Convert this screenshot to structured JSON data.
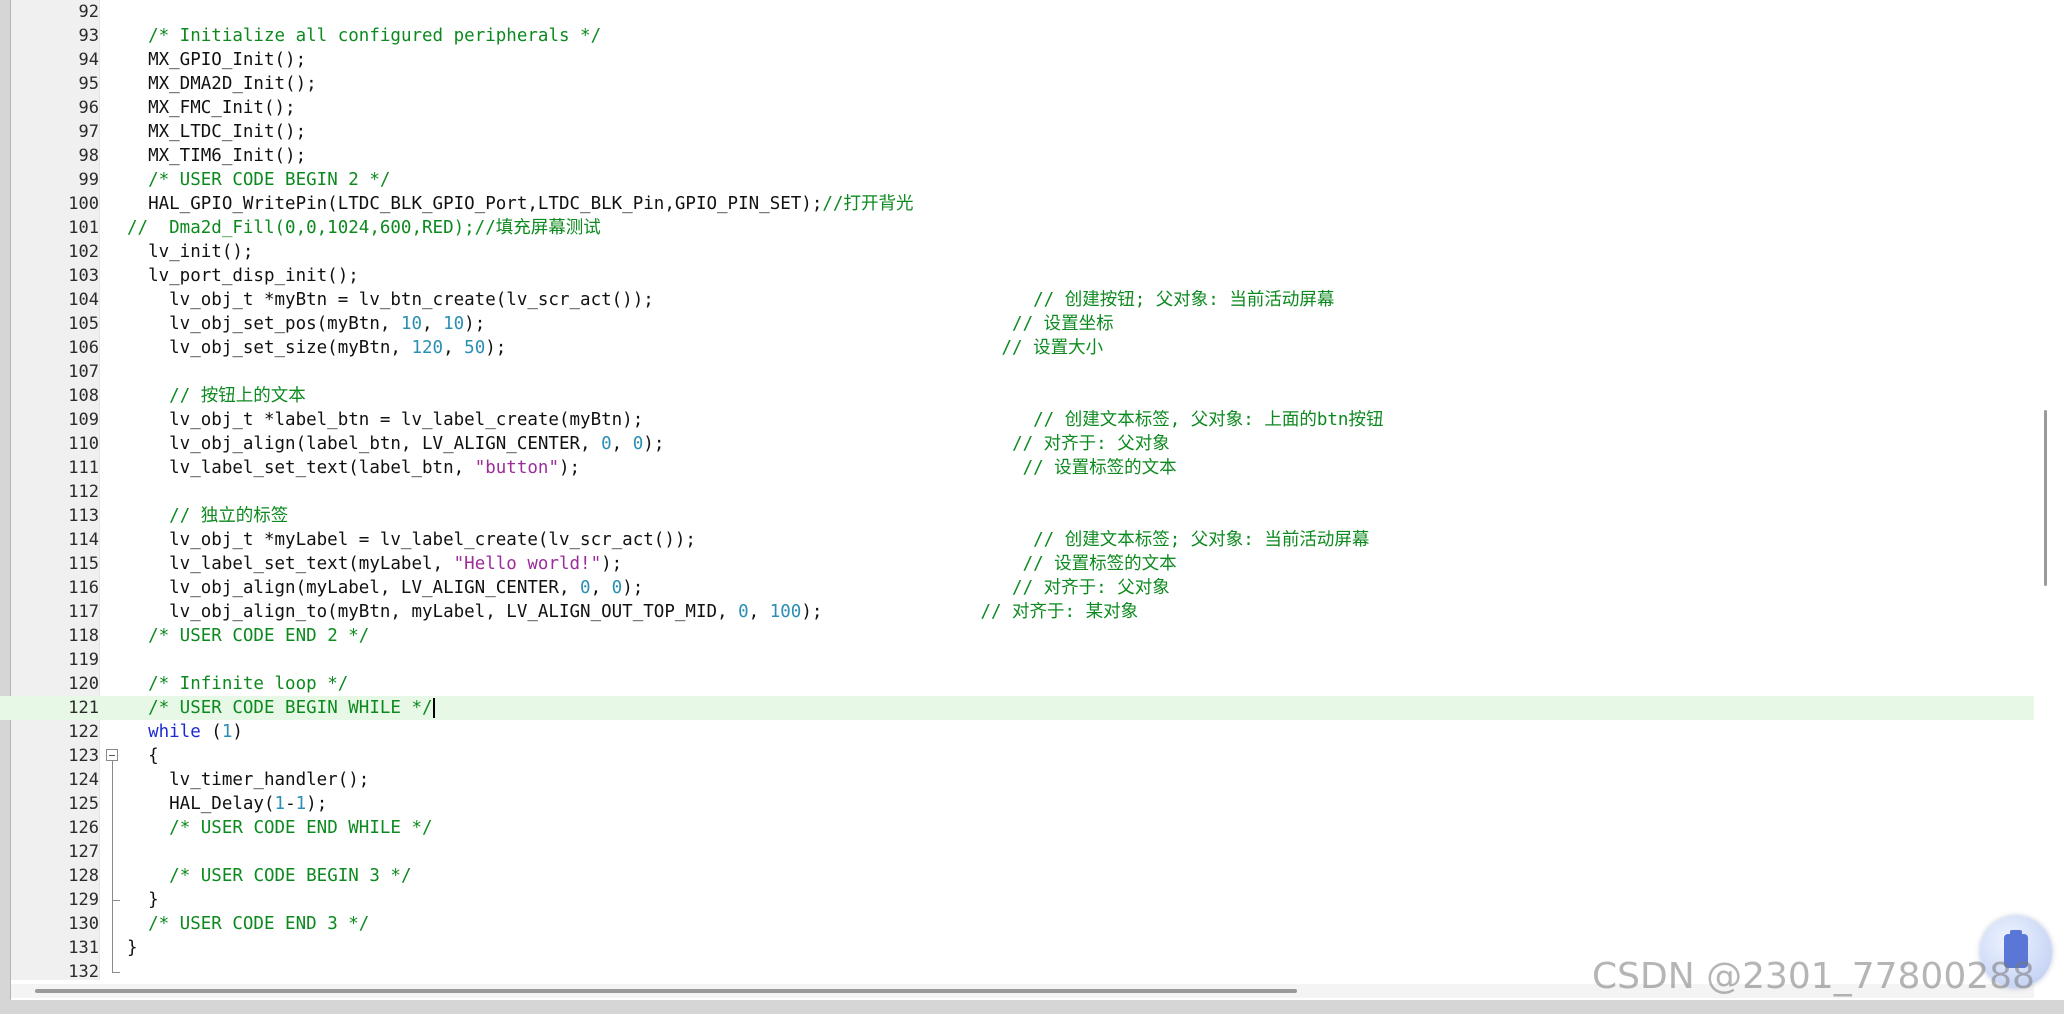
{
  "editor": {
    "lines": [
      {
        "n": "92",
        "parts": []
      },
      {
        "n": "93",
        "parts": [
          {
            "t": "  "
          },
          {
            "t": "/* Initialize all configured peripherals */",
            "c": "cm"
          }
        ]
      },
      {
        "n": "94",
        "parts": [
          {
            "t": "  MX_GPIO_Init();"
          }
        ]
      },
      {
        "n": "95",
        "parts": [
          {
            "t": "  MX_DMA2D_Init();"
          }
        ]
      },
      {
        "n": "96",
        "parts": [
          {
            "t": "  MX_FMC_Init();"
          }
        ]
      },
      {
        "n": "97",
        "parts": [
          {
            "t": "  MX_LTDC_Init();"
          }
        ]
      },
      {
        "n": "98",
        "parts": [
          {
            "t": "  MX_TIM6_Init();"
          }
        ]
      },
      {
        "n": "99",
        "parts": [
          {
            "t": "  "
          },
          {
            "t": "/* USER CODE BEGIN 2 */",
            "c": "cm"
          }
        ]
      },
      {
        "n": "100",
        "parts": [
          {
            "t": "  HAL_GPIO_WritePin(LTDC_BLK_GPIO_Port,LTDC_BLK_Pin,GPIO_PIN_SET);"
          },
          {
            "t": "//打开背光",
            "c": "cm"
          }
        ]
      },
      {
        "n": "101",
        "parts": [
          {
            "t": "//  Dma2d_Fill(0,0,1024,600,RED);//填充屏幕测试",
            "c": "cm"
          }
        ]
      },
      {
        "n": "102",
        "parts": [
          {
            "t": "  lv_init();"
          }
        ]
      },
      {
        "n": "103",
        "parts": [
          {
            "t": "  lv_port_disp_init();"
          }
        ]
      },
      {
        "n": "104",
        "parts": [
          {
            "t": "    lv_obj_t *myBtn = lv_btn_create(lv_scr_act());                                    "
          },
          {
            "t": "// 创建按钮; 父对象: 当前活动屏幕",
            "c": "cm"
          }
        ]
      },
      {
        "n": "105",
        "parts": [
          {
            "t": "    lv_obj_set_pos(myBtn, "
          },
          {
            "t": "10",
            "c": "num"
          },
          {
            "t": ", "
          },
          {
            "t": "10",
            "c": "num"
          },
          {
            "t": ");                                                  "
          },
          {
            "t": "// 设置坐标",
            "c": "cm"
          }
        ]
      },
      {
        "n": "106",
        "parts": [
          {
            "t": "    lv_obj_set_size(myBtn, "
          },
          {
            "t": "120",
            "c": "num"
          },
          {
            "t": ", "
          },
          {
            "t": "50",
            "c": "num"
          },
          {
            "t": ");                                               "
          },
          {
            "t": "// 设置大小",
            "c": "cm"
          }
        ]
      },
      {
        "n": "107",
        "parts": []
      },
      {
        "n": "108",
        "parts": [
          {
            "t": "    "
          },
          {
            "t": "// 按钮上的文本",
            "c": "cm"
          }
        ]
      },
      {
        "n": "109",
        "parts": [
          {
            "t": "    lv_obj_t *label_btn = lv_label_create(myBtn);                                     "
          },
          {
            "t": "// 创建文本标签, 父对象: 上面的btn按钮",
            "c": "cm"
          }
        ]
      },
      {
        "n": "110",
        "parts": [
          {
            "t": "    lv_obj_align(label_btn, LV_ALIGN_CENTER, "
          },
          {
            "t": "0",
            "c": "num"
          },
          {
            "t": ", "
          },
          {
            "t": "0",
            "c": "num"
          },
          {
            "t": ");                                 "
          },
          {
            "t": "// 对齐于: 父对象",
            "c": "cm"
          }
        ]
      },
      {
        "n": "111",
        "parts": [
          {
            "t": "    lv_label_set_text(label_btn, "
          },
          {
            "t": "\"button\"",
            "c": "str"
          },
          {
            "t": ");                                          "
          },
          {
            "t": "// 设置标签的文本",
            "c": "cm"
          }
        ]
      },
      {
        "n": "112",
        "parts": []
      },
      {
        "n": "113",
        "parts": [
          {
            "t": "    "
          },
          {
            "t": "// 独立的标签",
            "c": "cm"
          }
        ]
      },
      {
        "n": "114",
        "parts": [
          {
            "t": "    lv_obj_t *myLabel = lv_label_create(lv_scr_act());                                "
          },
          {
            "t": "// 创建文本标签; 父对象: 当前活动屏幕",
            "c": "cm"
          }
        ]
      },
      {
        "n": "115",
        "parts": [
          {
            "t": "    lv_label_set_text(myLabel, "
          },
          {
            "t": "\"Hello world!\"",
            "c": "str"
          },
          {
            "t": ");                                      "
          },
          {
            "t": "// 设置标签的文本",
            "c": "cm"
          }
        ]
      },
      {
        "n": "116",
        "parts": [
          {
            "t": "    lv_obj_align(myLabel, LV_ALIGN_CENTER, "
          },
          {
            "t": "0",
            "c": "num"
          },
          {
            "t": ", "
          },
          {
            "t": "0",
            "c": "num"
          },
          {
            "t": ");                                   "
          },
          {
            "t": "// 对齐于: 父对象",
            "c": "cm"
          }
        ]
      },
      {
        "n": "117",
        "parts": [
          {
            "t": "    lv_obj_align_to(myBtn, myLabel, LV_ALIGN_OUT_TOP_MID, "
          },
          {
            "t": "0",
            "c": "num"
          },
          {
            "t": ", "
          },
          {
            "t": "100",
            "c": "num"
          },
          {
            "t": ");               "
          },
          {
            "t": "// 对齐于: 某对象",
            "c": "cm"
          }
        ]
      },
      {
        "n": "118",
        "parts": [
          {
            "t": "  "
          },
          {
            "t": "/* USER CODE END 2 */",
            "c": "cm"
          }
        ]
      },
      {
        "n": "119",
        "parts": []
      },
      {
        "n": "120",
        "parts": [
          {
            "t": "  "
          },
          {
            "t": "/* Infinite loop */",
            "c": "cm"
          }
        ]
      },
      {
        "n": "121",
        "parts": [
          {
            "t": "  "
          },
          {
            "t": "/* USER CODE BEGIN WHILE */",
            "c": "cm"
          }
        ],
        "current": true,
        "caret": true
      },
      {
        "n": "122",
        "parts": [
          {
            "t": "  "
          },
          {
            "t": "while",
            "c": "kw"
          },
          {
            "t": " ("
          },
          {
            "t": "1",
            "c": "num"
          },
          {
            "t": ")"
          }
        ]
      },
      {
        "n": "123",
        "parts": [
          {
            "t": "  {"
          }
        ],
        "fold": "start"
      },
      {
        "n": "124",
        "parts": [
          {
            "t": "    lv_timer_handler();"
          }
        ]
      },
      {
        "n": "125",
        "parts": [
          {
            "t": "    HAL_Delay("
          },
          {
            "t": "1",
            "c": "num"
          },
          {
            "t": "-"
          },
          {
            "t": "1",
            "c": "num"
          },
          {
            "t": ");"
          }
        ]
      },
      {
        "n": "126",
        "parts": [
          {
            "t": "    "
          },
          {
            "t": "/* USER CODE END WHILE */",
            "c": "cm"
          }
        ]
      },
      {
        "n": "127",
        "parts": []
      },
      {
        "n": "128",
        "parts": [
          {
            "t": "    "
          },
          {
            "t": "/* USER CODE BEGIN 3 */",
            "c": "cm"
          }
        ]
      },
      {
        "n": "129",
        "parts": [
          {
            "t": "  }"
          }
        ],
        "fold": "end"
      },
      {
        "n": "130",
        "parts": [
          {
            "t": "  "
          },
          {
            "t": "/* USER CODE END 3 */",
            "c": "cm"
          }
        ]
      },
      {
        "n": "131",
        "parts": [
          {
            "t": "}"
          }
        ]
      },
      {
        "n": "132",
        "parts": [],
        "fold": "end"
      }
    ]
  },
  "watermark": "CSDN @2301_77800288",
  "colors": {
    "comment": "#0d8a1f",
    "string": "#9b2d9b",
    "number": "#2b8fb4",
    "keyword": "#1c2bd0",
    "current_line": "#e8f8e6"
  },
  "icons": {
    "fold_toggle": "minus-box-icon",
    "widget": "battery-icon"
  }
}
